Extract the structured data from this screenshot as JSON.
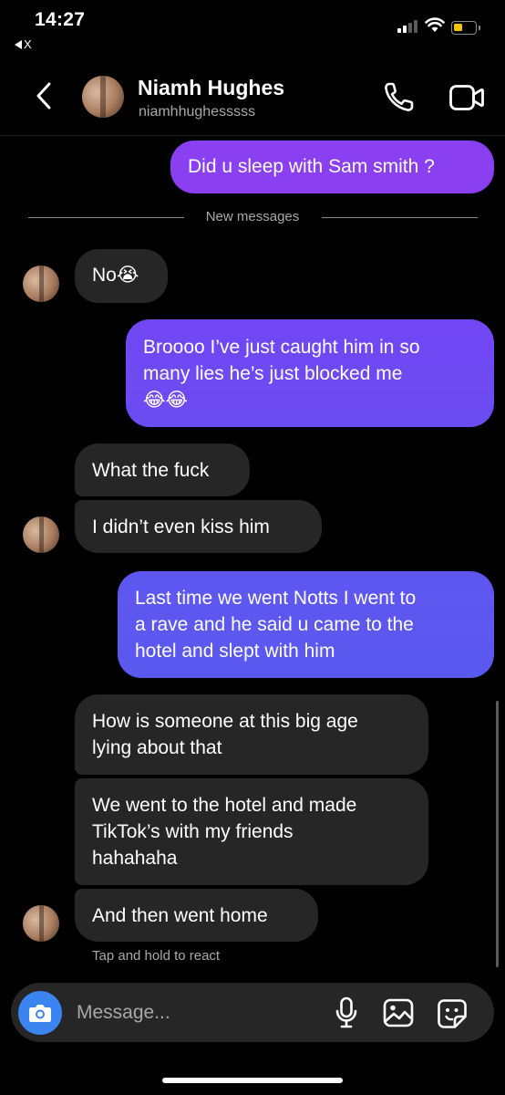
{
  "status_bar": {
    "time": "14:27",
    "back_app": "X"
  },
  "header": {
    "name": "Niamh Hughes",
    "username": "niamhhughesssss"
  },
  "divider": {
    "label": "New messages"
  },
  "messages": {
    "m1": "Did u sleep with Sam smith ?",
    "m2": "No😭",
    "m3a": "Broooo I’ve just caught him in so",
    "m3b": "many lies he’s just blocked me",
    "m3c": "😂😂",
    "m4": "What the fuck",
    "m5": "I didn’t even kiss him",
    "m6a": "Last time we went Notts I went to",
    "m6b": "a rave and he said u came to the",
    "m6c": "hotel and slept with him",
    "m7a": "How is someone at this big age",
    "m7b": "lying about that",
    "m8a": "We went to the hotel and made",
    "m8b": "TikTok’s with my friends",
    "m8c": "hahahaha",
    "m9": "And then went home"
  },
  "react_hint": "Tap and hold to react",
  "composer": {
    "placeholder": "Message..."
  },
  "icons": {
    "back": "chevron-left-icon",
    "call": "phone-icon",
    "video": "video-camera-icon",
    "camera": "camera-icon",
    "mic": "microphone-icon",
    "gallery": "image-icon",
    "sticker": "sticker-icon"
  },
  "colors": {
    "outgoing_top": "#8a3ff0",
    "outgoing_bottom": "#5a59ef",
    "incoming": "#262626",
    "camera_button": "#3a85f0",
    "battery": "#f4c500"
  }
}
